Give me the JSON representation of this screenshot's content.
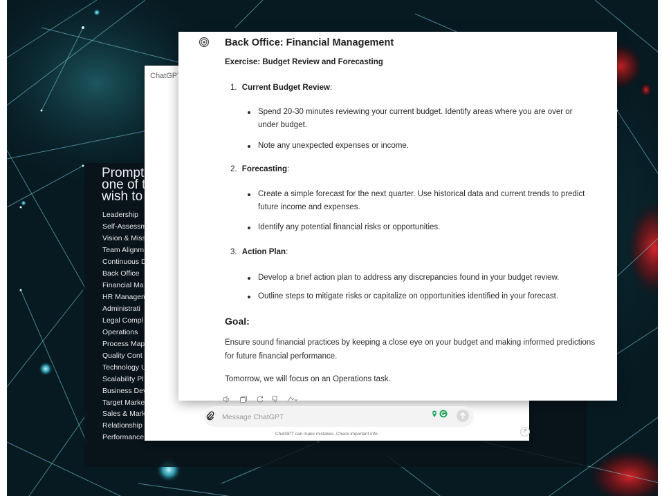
{
  "colors": {
    "background": "#061820",
    "network_lines": "#7fd8e6",
    "glow_red": "#d21a1a",
    "glow_cyan": "#5fe0ef",
    "text": "#1f1f1f",
    "ext_green": "#1aa35a"
  },
  "prompt_panel": {
    "title_lines": [
      "Prompt",
      "one of t",
      "wish to"
    ],
    "items": [
      "Leadership",
      "Self-Assessm",
      "Vision & Miss",
      "Team Alignm",
      "Continuous D",
      "Back Office",
      "Financial Ma",
      "HR Managem",
      "Administrati",
      "Legal Compl",
      "Operations",
      "Process Map",
      "Quality Cont",
      "Technology U",
      "Scalability Pl",
      "Business Dev",
      "Target Marke",
      "Sales & Mark",
      "Relationship",
      "Performance"
    ]
  },
  "back_window": {
    "title": "ChatGPT"
  },
  "chat": {
    "avatar_icon": "chatgpt-logo-icon",
    "heading": "Back Office: Financial Management",
    "subheading": "Exercise: Budget Review and Forecasting",
    "sections": [
      {
        "number": "1.",
        "title": "Current Budget Review",
        "bullets": [
          "Spend 20-30 minutes reviewing your current budget. Identify areas where you are over or under budget.",
          "Note any unexpected expenses or income."
        ]
      },
      {
        "number": "2.",
        "title": "Forecasting",
        "bullets": [
          "Create a simple forecast for the next quarter. Use historical data and current trends to predict future income and expenses.",
          "Identify any potential financial risks or opportunities."
        ]
      },
      {
        "number": "3.",
        "title": "Action Plan",
        "bullets": [
          "Develop a brief action plan to address any discrepancies found in your budget review.",
          "Outline steps to mitigate risks or capitalize on opportunities identified in your forecast."
        ]
      }
    ],
    "goal_heading": "Goal:",
    "goal_text": "Ensure sound financial practices by keeping a close eye on your budget and making informed predictions for future financial performance.",
    "closing": "Tomorrow, we will focus on an Operations task.",
    "action_icons": [
      "read-aloud-icon",
      "copy-icon",
      "regenerate-icon",
      "thumbs-down-icon",
      "model-switch-icon"
    ]
  },
  "composer": {
    "placeholder": "Message ChatGPT",
    "attach_icon": "paperclip-icon",
    "extension_icons": [
      "location-pin-icon",
      "grammarly-icon"
    ],
    "send_icon": "arrow-up-icon",
    "disclaimer": "ChatGPT can make mistakes. Check important info.",
    "help_label": "?"
  },
  "slide_colon": ":"
}
